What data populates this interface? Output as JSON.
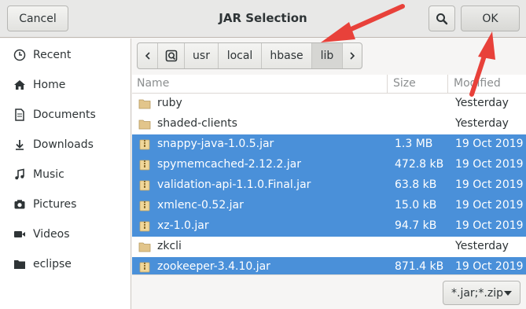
{
  "dialog": {
    "title": "JAR Selection",
    "cancel_label": "Cancel",
    "ok_label": "OK"
  },
  "sidebar": {
    "items": [
      {
        "label": "Recent",
        "icon": "clock-icon"
      },
      {
        "label": "Home",
        "icon": "home-icon"
      },
      {
        "label": "Documents",
        "icon": "document-icon"
      },
      {
        "label": "Downloads",
        "icon": "download-icon"
      },
      {
        "label": "Music",
        "icon": "music-icon"
      },
      {
        "label": "Pictures",
        "icon": "camera-icon"
      },
      {
        "label": "Videos",
        "icon": "video-icon"
      },
      {
        "label": "eclipse",
        "icon": "folder-icon"
      }
    ]
  },
  "pathbar": {
    "segments": [
      "usr",
      "local",
      "hbase",
      "lib"
    ],
    "active": "lib"
  },
  "columns": {
    "name": "Name",
    "size": "Size",
    "modified": "Modified"
  },
  "files": [
    {
      "name": "ruby",
      "size": "",
      "modified": "Yesterday",
      "type": "folder",
      "selected": false
    },
    {
      "name": "shaded-clients",
      "size": "",
      "modified": "Yesterday",
      "type": "folder",
      "selected": false
    },
    {
      "name": "snappy-java-1.0.5.jar",
      "size": "1.3 MB",
      "modified": "19 Oct 2019",
      "type": "archive",
      "selected": true
    },
    {
      "name": "spymemcached-2.12.2.jar",
      "size": "472.8 kB",
      "modified": "19 Oct 2019",
      "type": "archive",
      "selected": true
    },
    {
      "name": "validation-api-1.1.0.Final.jar",
      "size": "63.8 kB",
      "modified": "19 Oct 2019",
      "type": "archive",
      "selected": true
    },
    {
      "name": "xmlenc-0.52.jar",
      "size": "15.0 kB",
      "modified": "19 Oct 2019",
      "type": "archive",
      "selected": true
    },
    {
      "name": "xz-1.0.jar",
      "size": "94.7 kB",
      "modified": "19 Oct 2019",
      "type": "archive",
      "selected": true
    },
    {
      "name": "zkcli",
      "size": "",
      "modified": "Yesterday",
      "type": "folder",
      "selected": false
    },
    {
      "name": "zookeeper-3.4.10.jar",
      "size": "871.4 kB",
      "modified": "19 Oct 2019",
      "type": "archive",
      "selected": true
    }
  ],
  "filter": {
    "label": "*.jar;*.zip"
  },
  "colors": {
    "selection": "#4a90d9",
    "annotation_arrow": "#e8413a"
  }
}
